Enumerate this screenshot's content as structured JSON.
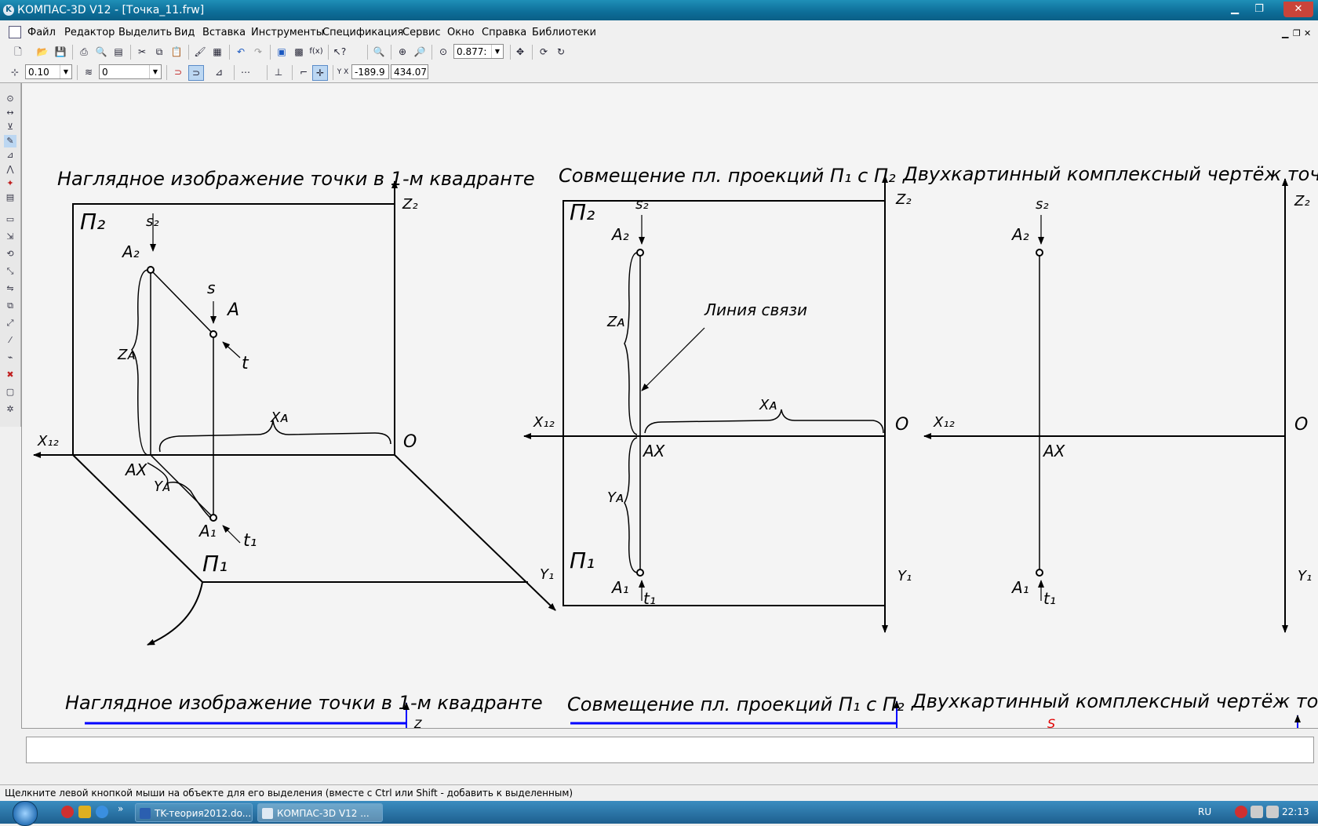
{
  "window": {
    "title": "КОМПАС-3D V12 - [Точка_11.frw]",
    "icon": "kompas-icon"
  },
  "menu": [
    "Файл",
    "Редактор",
    "Выделить",
    "Вид",
    "Вставка",
    "Инструменты",
    "Спецификация",
    "Сервис",
    "Окно",
    "Справка",
    "Библиотеки"
  ],
  "toolbar": {
    "zoom_value": "0.877:",
    "step_value": "0.10",
    "layer_value": "0",
    "coord_x": "-189.9",
    "coord_y": "434.07",
    "coord_label": "Y X"
  },
  "drawing": {
    "title1": "Наглядное изображение точки в 1-м    квадранте",
    "title2": "Совмещение пл. проекций П₁ с П₂",
    "title3": "Двухкартинный комплексный чертёж точки",
    "link_label": "Линия связи",
    "lbl_p2": "П₂",
    "lbl_p1": "П₁",
    "lbl_z2": "Z₂",
    "lbl_y1": "Y₁",
    "lbl_x12": "X₁₂",
    "lbl_o": "O",
    "lbl_a": "A",
    "lbl_a1": "A₁",
    "lbl_a2": "A₂",
    "lbl_ax": "AX",
    "lbl_s": "s",
    "lbl_s2": "s₂",
    "lbl_t": "t",
    "lbl_t1": "t₁",
    "lbl_xa": "Xᴀ",
    "lbl_ya": "Yᴀ",
    "lbl_za": "Zᴀ",
    "bottom_title1": "Наглядное изображение точки в 1-м    квадранте",
    "bottom_title2": "Совмещение пл. проекций П₁ с П₂",
    "bottom_title3": "Двухкартинный комплексный чертёж точки",
    "bottom_z": "Z",
    "bottom_s": "S"
  },
  "status": {
    "hint": "Щелкните левой кнопкой мыши на объекте для его выделения (вместе с Ctrl или Shift - добавить к выделенным)"
  },
  "taskbar": {
    "tasks": [
      "TK-теория2012.do...",
      "КОМПАС-3D V12 ..."
    ],
    "lang": "RU",
    "clock": "22:13"
  },
  "colors": {
    "titlebar": "#0d6d98",
    "canvas": "#f4f4f4",
    "selection_blue": "#0000ff",
    "accent_red": "#e00000"
  }
}
